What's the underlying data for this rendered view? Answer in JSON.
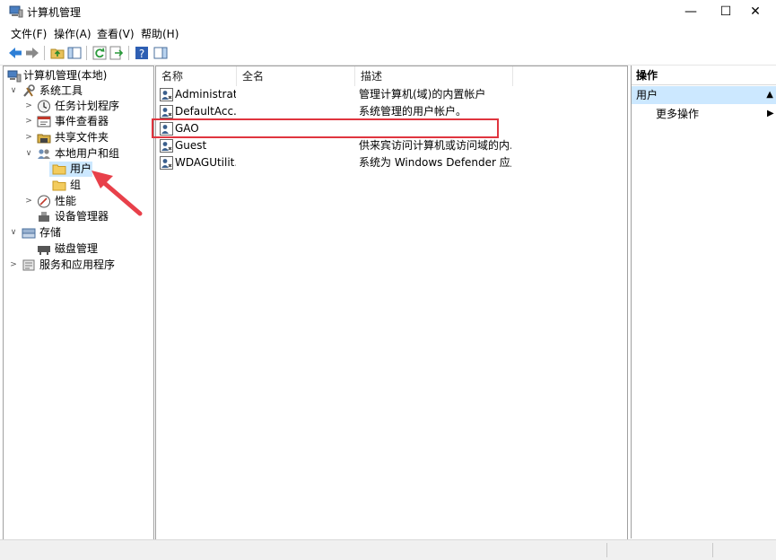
{
  "window": {
    "title": "计算机管理",
    "minimize_glyph": "—",
    "maximize_glyph": "☐",
    "close_glyph": "✕"
  },
  "menu": [
    "文件(F)",
    "操作(A)",
    "查看(V)",
    "帮助(H)"
  ],
  "toolbar": {
    "icons": [
      "back-icon",
      "forward-icon",
      "up-folder-icon",
      "show-hide-tree-icon",
      "refresh-icon",
      "export-list-icon",
      "help-icon",
      "action-pane-icon"
    ]
  },
  "tree": [
    {
      "label": "计算机管理(本地)",
      "icon": "computer-management-icon",
      "level": 0,
      "expander": ""
    },
    {
      "label": "系统工具",
      "icon": "tools-icon",
      "level": 1,
      "expander": "∨"
    },
    {
      "label": "任务计划程序",
      "icon": "task-scheduler-icon",
      "level": 2,
      "expander": ">"
    },
    {
      "label": "事件查看器",
      "icon": "event-viewer-icon",
      "level": 2,
      "expander": ">"
    },
    {
      "label": "共享文件夹",
      "icon": "shared-folder-icon",
      "level": 2,
      "expander": ">"
    },
    {
      "label": "本地用户和组",
      "icon": "local-users-groups-icon",
      "level": 2,
      "expander": "∨"
    },
    {
      "label": "用户",
      "icon": "folder-icon",
      "level": 3,
      "expander": "",
      "selected": true
    },
    {
      "label": "组",
      "icon": "folder-icon",
      "level": 3,
      "expander": ""
    },
    {
      "label": "性能",
      "icon": "performance-icon",
      "level": 2,
      "expander": ">"
    },
    {
      "label": "设备管理器",
      "icon": "device-manager-icon",
      "level": 2,
      "expander": ""
    },
    {
      "label": "存储",
      "icon": "storage-icon",
      "level": 1,
      "expander": "∨"
    },
    {
      "label": "磁盘管理",
      "icon": "disk-management-icon",
      "level": 2,
      "expander": ""
    },
    {
      "label": "服务和应用程序",
      "icon": "services-apps-icon",
      "level": 1,
      "expander": ">"
    }
  ],
  "list": {
    "columns": [
      "名称",
      "全名",
      "描述"
    ],
    "rows": [
      {
        "name": "Administrat...",
        "fullname": "",
        "description": "管理计算机(域)的内置帐户"
      },
      {
        "name": "DefaultAcc...",
        "fullname": "",
        "description": "系统管理的用户帐户。"
      },
      {
        "name": "GAO",
        "fullname": "",
        "description": ""
      },
      {
        "name": "Guest",
        "fullname": "",
        "description": "供来宾访问计算机或访问域的内..."
      },
      {
        "name": "WDAGUtilit...",
        "fullname": "",
        "description": "系统为 Windows Defender 应用..."
      }
    ]
  },
  "actions": {
    "header": "操作",
    "section": "用户",
    "section_arrow": "▲",
    "more": "更多操作",
    "more_arrow": "▶"
  },
  "colors": {
    "highlight_box": "#e0353f",
    "arrow": "#e8404a",
    "selection": "#cce8ff"
  }
}
